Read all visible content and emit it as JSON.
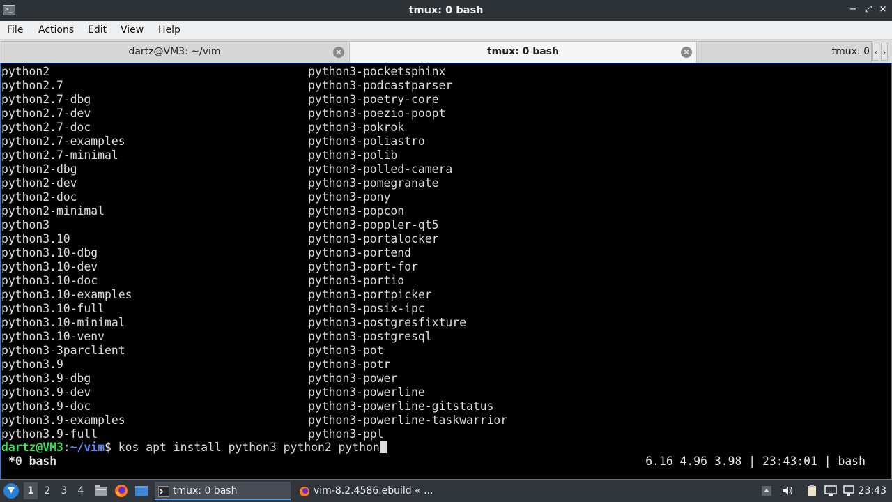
{
  "window": {
    "title": "tmux: 0 bash",
    "app_icon_glyph": ">_",
    "controls": {
      "minimize": "−",
      "maximize": "⤢",
      "close": "×"
    }
  },
  "menubar": {
    "items": [
      "File",
      "Actions",
      "Edit",
      "View",
      "Help"
    ]
  },
  "tabs": {
    "items": [
      {
        "label": "dartz@VM3: ~/vim",
        "active": false
      },
      {
        "label": "tmux: 0 bash",
        "active": true
      },
      {
        "label": "tmux: 0",
        "active": false
      }
    ],
    "close_glyph": "×",
    "scroll_left": "‹",
    "scroll_right": "›"
  },
  "terminal": {
    "left_column": [
      "python2",
      "python2.7",
      "python2.7-dbg",
      "python2.7-dev",
      "python2.7-doc",
      "python2.7-examples",
      "python2.7-minimal",
      "python2-dbg",
      "python2-dev",
      "python2-doc",
      "python2-minimal",
      "python3",
      "python3.10",
      "python3.10-dbg",
      "python3.10-dev",
      "python3.10-doc",
      "python3.10-examples",
      "python3.10-full",
      "python3.10-minimal",
      "python3.10-venv",
      "python3-3parclient",
      "python3.9",
      "python3.9-dbg",
      "python3.9-dev",
      "python3.9-doc",
      "python3.9-examples",
      "python3.9-full"
    ],
    "right_column": [
      "python3-pocketsphinx",
      "python3-podcastparser",
      "python3-poetry-core",
      "python3-poezio-poopt",
      "python3-pokrok",
      "python3-poliastro",
      "python3-polib",
      "python3-polled-camera",
      "python3-pomegranate",
      "python3-pony",
      "python3-popcon",
      "python3-poppler-qt5",
      "python3-portalocker",
      "python3-portend",
      "python3-port-for",
      "python3-portio",
      "python3-portpicker",
      "python3-posix-ipc",
      "python3-postgresfixture",
      "python3-postgresql",
      "python3-pot",
      "python3-potr",
      "python3-power",
      "python3-powerline",
      "python3-powerline-gitstatus",
      "python3-powerline-taskwarrior",
      "python3-ppl"
    ],
    "prompt": {
      "user_host": "dartz@VM3",
      "separator": ":",
      "path": "~/vim",
      "symbol": "$ ",
      "command": "kos apt install python3 python2 python"
    },
    "status_bar": {
      "left": "*0 bash",
      "right": "6.16 4.96 3.98 | 23:43:01 | bash"
    }
  },
  "taskbar": {
    "workspaces": [
      "1",
      "2",
      "3",
      "4"
    ],
    "active_workspace": "1",
    "tasks": [
      {
        "label": "tmux: 0 bash",
        "icon": "terminal-icon",
        "active": true
      },
      {
        "label": "vim-8.2.4586.ebuild « ...",
        "icon": "firefox-icon",
        "active": false
      }
    ],
    "clock": "23:43"
  },
  "colors": {
    "terminal_bg": "#000000",
    "terminal_fg": "#dcdcdc",
    "prompt_user": "#3fe05a",
    "prompt_path": "#5c8cf2",
    "focus_border": "#3a7cc7",
    "titlebar_bg": "#2e3338",
    "taskbar_bg": "#2f353b"
  }
}
